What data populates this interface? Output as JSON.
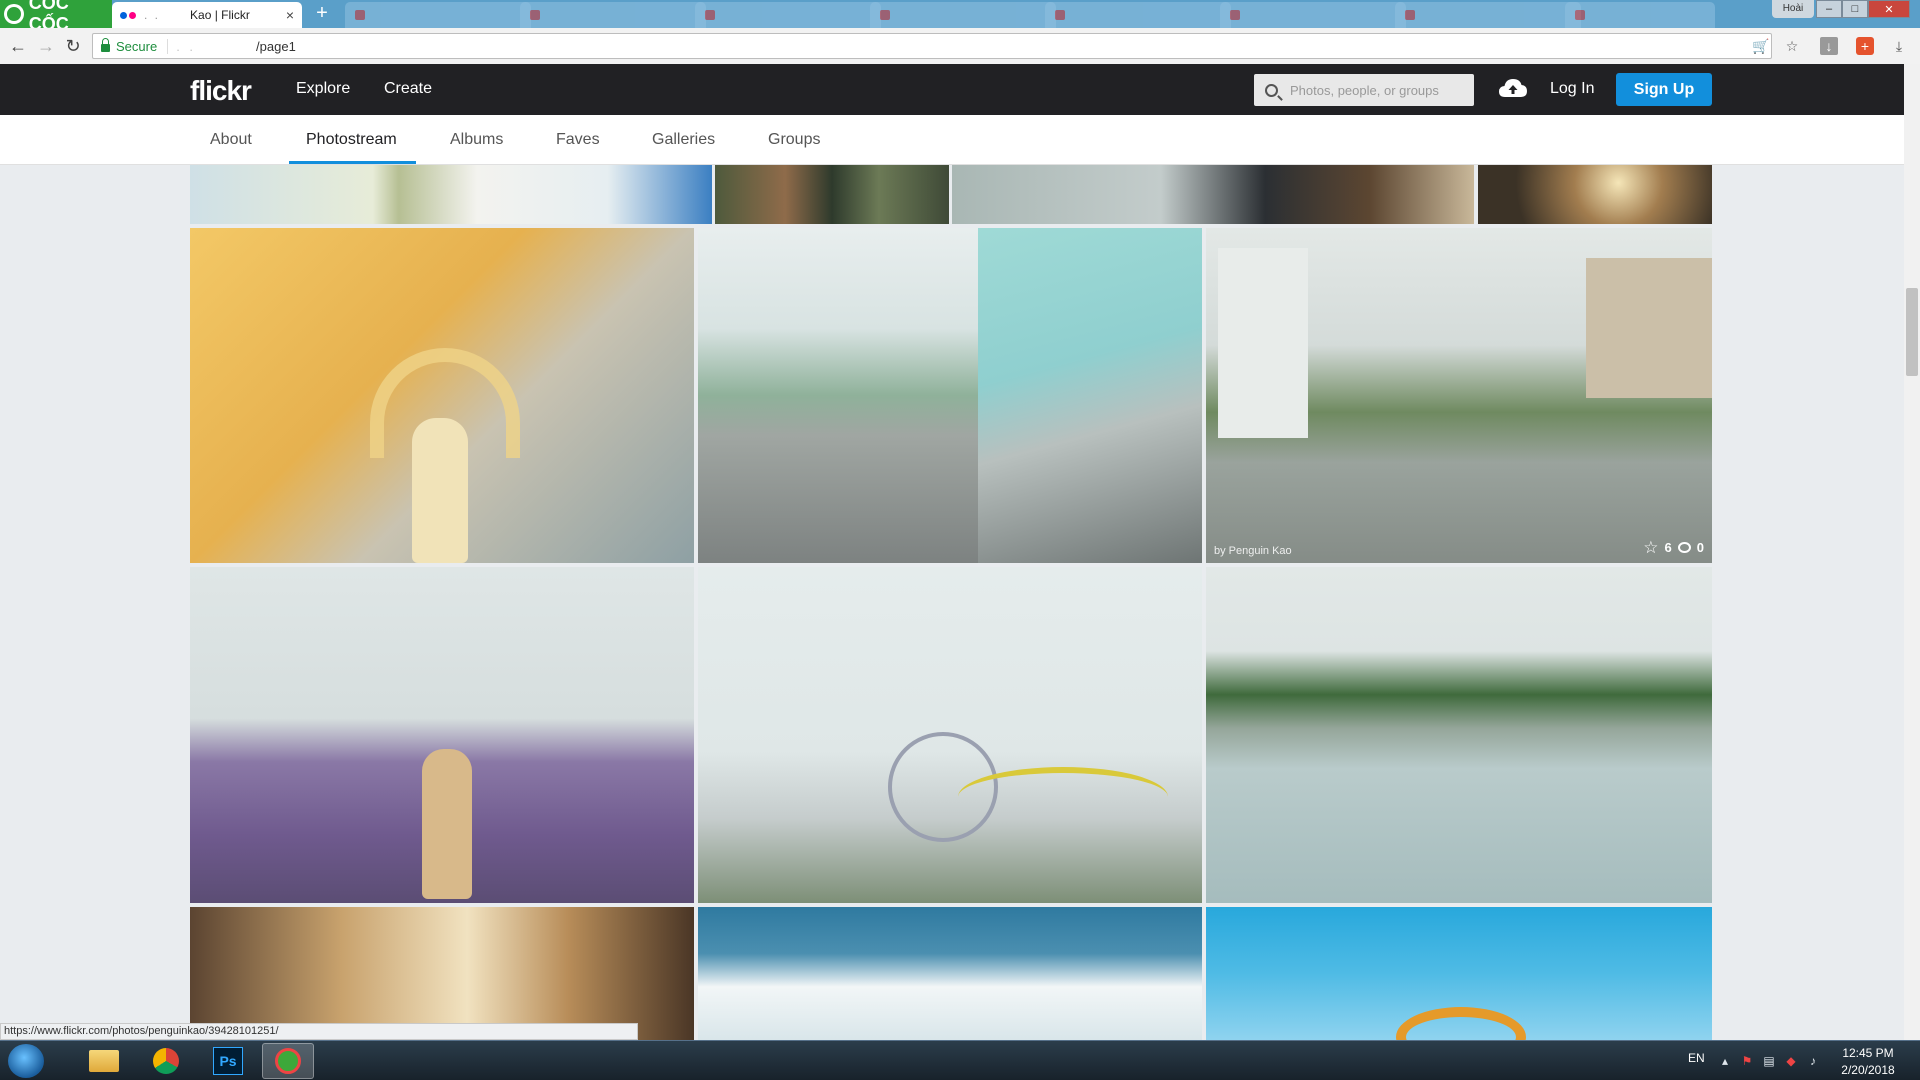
{
  "browser": {
    "brand_name": "CỐC CỐC",
    "active_tab_title": "Kao | Flickr",
    "tab_close": "×",
    "new_tab": "+",
    "profile_label": "Hoài",
    "address": {
      "secure_label": "Secure",
      "url_visible": "/page1"
    },
    "status_bar_url": "https://www.flickr.com/photos/penguinkao/39428101251/"
  },
  "flickr": {
    "logo": "flickr",
    "nav": {
      "explore": "Explore",
      "create": "Create"
    },
    "search_placeholder": "Photos, people, or groups",
    "login": "Log In",
    "signup": "Sign Up",
    "subnav": {
      "about": "About",
      "photostream": "Photostream",
      "albums": "Albums",
      "faves": "Faves",
      "galleries": "Galleries",
      "groups": "Groups"
    },
    "hovered_photo": {
      "author": "by Penguin Kao",
      "faves": "6",
      "comments": "0"
    }
  },
  "taskbar": {
    "language": "EN",
    "time": "12:45 PM",
    "date": "2/20/2018"
  },
  "colors": {
    "flickr_blue": "#128fdc",
    "header_dark": "#212124",
    "secure_green": "#1e8e3e"
  }
}
